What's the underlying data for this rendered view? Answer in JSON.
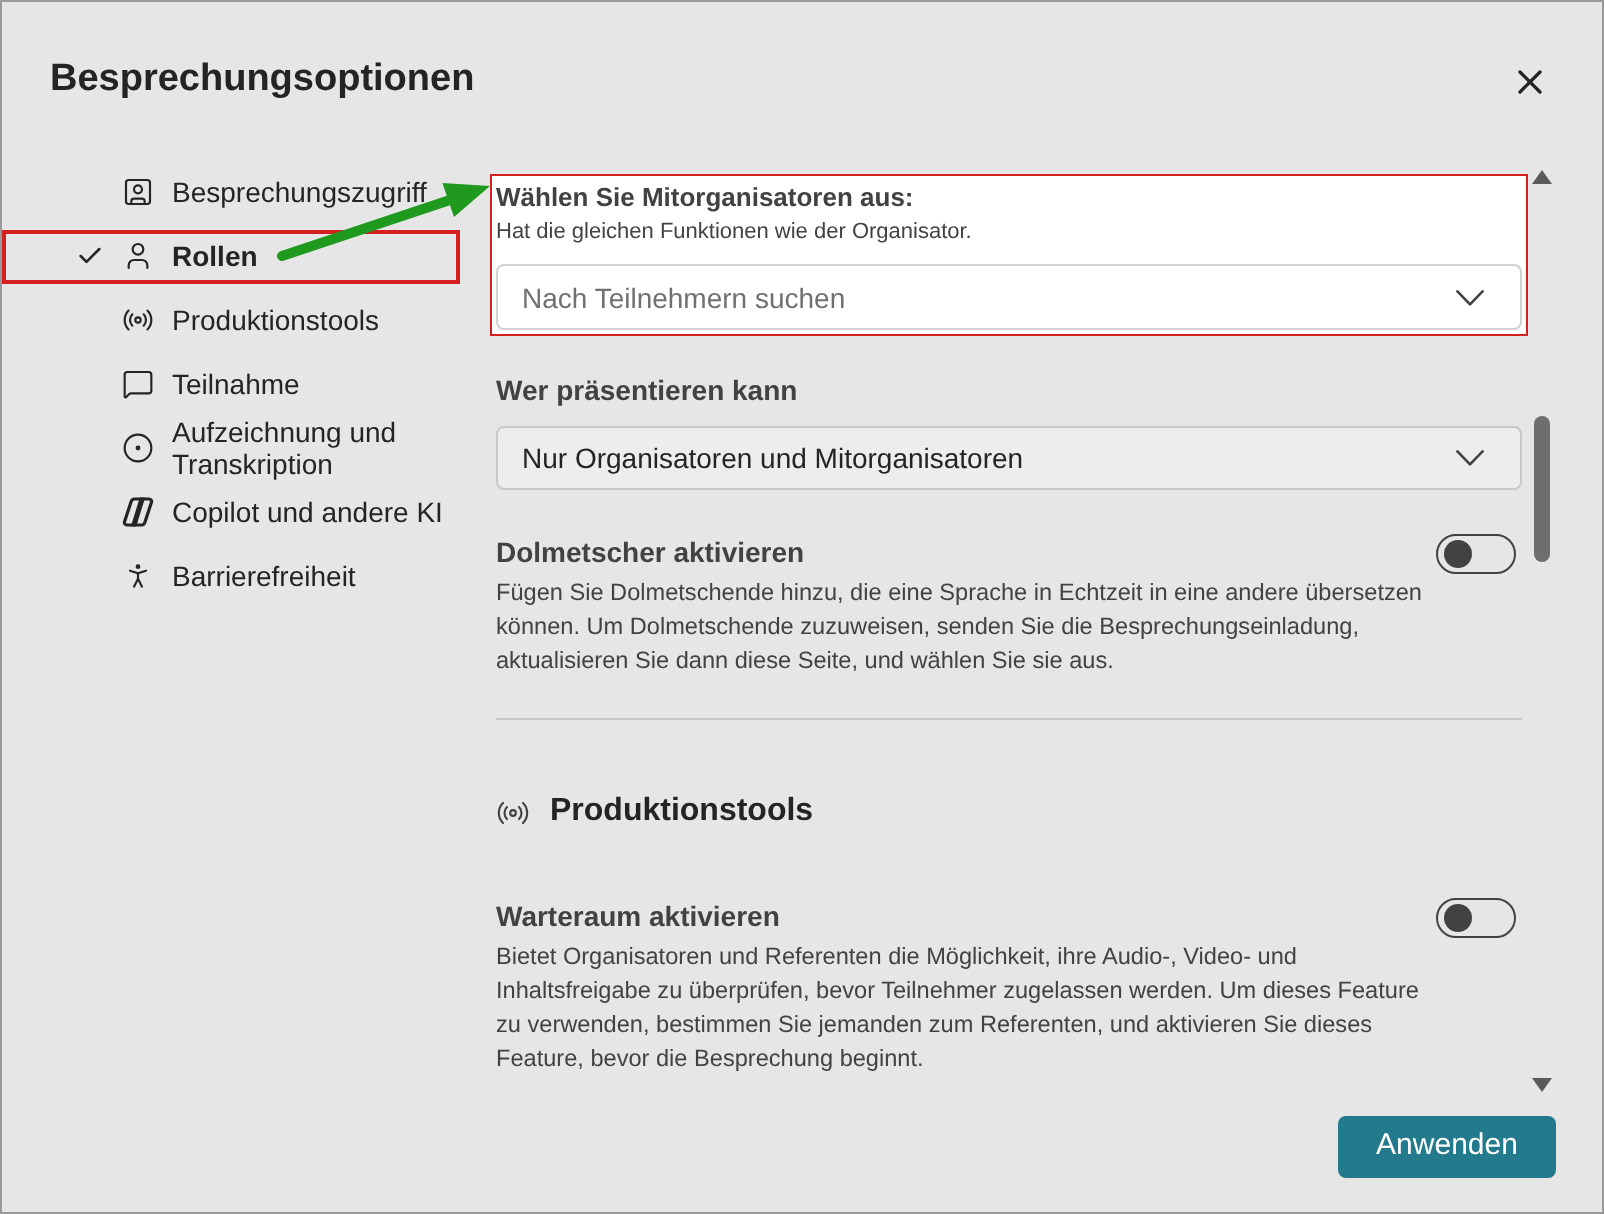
{
  "dialog": {
    "title": "Besprechungsoptionen"
  },
  "sidebar": {
    "items": [
      {
        "label": "Besprechungszugriff",
        "selected": false
      },
      {
        "label": "Rollen",
        "selected": true
      },
      {
        "label": "Produktionstools",
        "selected": false
      },
      {
        "label": "Teilnahme",
        "selected": false
      },
      {
        "label": "Aufzeichnung und Transkription",
        "selected": false
      },
      {
        "label": "Copilot und andere KI",
        "selected": false
      },
      {
        "label": "Barrierefreiheit",
        "selected": false
      }
    ]
  },
  "co_organizers": {
    "title": "Wählen Sie Mitorganisatoren aus:",
    "hint": "Hat die gleichen Funktionen wie der Organisator.",
    "search": {
      "placeholder": "Nach Teilnehmern suchen"
    }
  },
  "presenters": {
    "label": "Wer präsentieren kann",
    "value": "Nur Organisatoren und Mitorganisatoren"
  },
  "toggles": [
    {
      "title": "Dolmetscher aktivieren",
      "description": "Fügen Sie Dolmetschende hinzu, die eine Sprache in Echtzeit in eine andere übersetzen können. Um Dolmetschende zuzuweisen, senden Sie die Besprechungseinladung, aktualisieren Sie dann diese Seite, und wählen Sie sie aus.",
      "on": false
    }
  ],
  "sections": [
    {
      "title": "Produktionstools",
      "toggles": [
        {
          "title": "Warteraum aktivieren",
          "description": "Bietet Organisatoren und Referenten die Möglichkeit, ihre Audio-, Video- und Inhaltsfreigabe zu überprüfen, bevor Teilnehmer zugelassen werden. Um dieses Feature zu verwenden, bestimmen Sie jemanden zum Referenten, und aktivieren Sie dieses Feature, bevor die Besprechung beginnt.",
          "on": false
        }
      ]
    }
  ],
  "footer": {
    "apply_button": "Anwenden"
  }
}
